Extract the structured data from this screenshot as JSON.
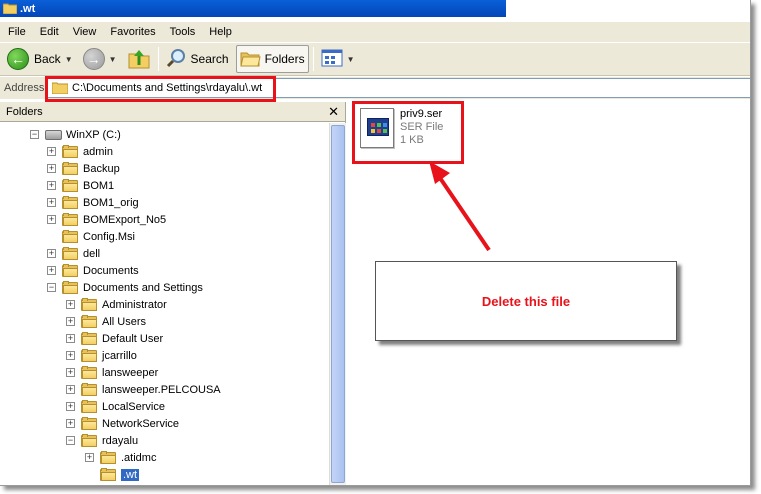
{
  "window": {
    "title": ".wt"
  },
  "menu": [
    "File",
    "Edit",
    "View",
    "Favorites",
    "Tools",
    "Help"
  ],
  "toolbar": {
    "back_label": "Back",
    "search_label": "Search",
    "folders_label": "Folders"
  },
  "address": {
    "label": "Address",
    "path": "C:\\Documents and Settings\\rdayalu\\.wt"
  },
  "folders_pane": {
    "title": "Folders",
    "tree": [
      {
        "label": "WinXP (C:)",
        "level": 0,
        "expander": "minus",
        "icon": "drive-icon"
      },
      {
        "label": "admin",
        "level": 1,
        "expander": "plus",
        "icon": "folder-icon"
      },
      {
        "label": "Backup",
        "level": 1,
        "expander": "plus",
        "icon": "folder-icon"
      },
      {
        "label": "BOM1",
        "level": 1,
        "expander": "plus",
        "icon": "folder-icon"
      },
      {
        "label": "BOM1_orig",
        "level": 1,
        "expander": "plus",
        "icon": "folder-icon"
      },
      {
        "label": "BOMExport_No5",
        "level": 1,
        "expander": "plus",
        "icon": "folder-icon"
      },
      {
        "label": "Config.Msi",
        "level": 1,
        "expander": "none",
        "icon": "folder-icon"
      },
      {
        "label": "dell",
        "level": 1,
        "expander": "plus",
        "icon": "folder-icon"
      },
      {
        "label": "Documents",
        "level": 1,
        "expander": "plus",
        "icon": "folder-icon"
      },
      {
        "label": "Documents and Settings",
        "level": 1,
        "expander": "minus",
        "icon": "folder-icon"
      },
      {
        "label": "Administrator",
        "level": 2,
        "expander": "plus",
        "icon": "folder-icon"
      },
      {
        "label": "All Users",
        "level": 2,
        "expander": "plus",
        "icon": "folder-icon"
      },
      {
        "label": "Default User",
        "level": 2,
        "expander": "plus",
        "icon": "folder-icon"
      },
      {
        "label": "jcarrillo",
        "level": 2,
        "expander": "plus",
        "icon": "folder-icon"
      },
      {
        "label": "lansweeper",
        "level": 2,
        "expander": "plus",
        "icon": "folder-icon"
      },
      {
        "label": "lansweeper.PELCOUSA",
        "level": 2,
        "expander": "plus",
        "icon": "folder-icon"
      },
      {
        "label": "LocalService",
        "level": 2,
        "expander": "plus",
        "icon": "folder-icon"
      },
      {
        "label": "NetworkService",
        "level": 2,
        "expander": "plus",
        "icon": "folder-icon"
      },
      {
        "label": "rdayalu",
        "level": 2,
        "expander": "minus",
        "icon": "folder-icon"
      },
      {
        "label": ".atidmc",
        "level": 3,
        "expander": "plus",
        "icon": "folder-icon"
      },
      {
        "label": ".wt",
        "level": 3,
        "expander": "none",
        "icon": "folder-icon",
        "selected": true
      }
    ]
  },
  "file": {
    "name": "priv9.ser",
    "type": "SER File",
    "size": "1 KB"
  },
  "callout": {
    "text": "Delete this file"
  },
  "colors": {
    "annotation_red": "#e8121a",
    "titlebar_blue": "#0a5fd8",
    "chrome": "#ece9d8"
  }
}
